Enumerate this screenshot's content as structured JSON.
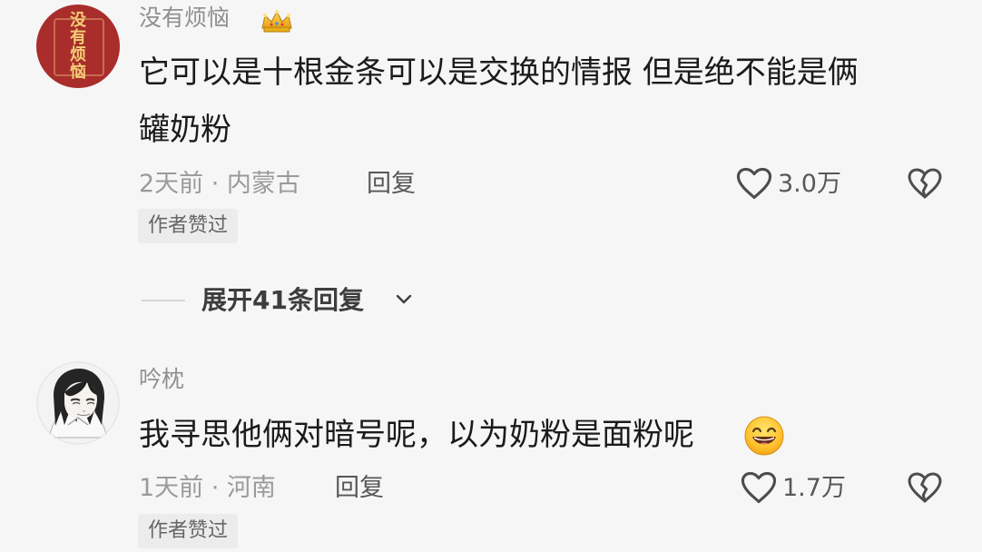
{
  "comments": [
    {
      "username": "没有烦恼",
      "badge_icon": "crown-icon",
      "avatar_text": [
        "没",
        "有",
        "烦",
        "恼"
      ],
      "text_line1": "它可以是十根金条可以是交换的情报  但是绝不能是俩",
      "text_line2": "罐奶粉",
      "meta": "2天前 · 内蒙古",
      "reply_label": "回复",
      "like_count": "3.0万",
      "author_tag": "作者赞过"
    },
    {
      "username": "吟枕",
      "text_line1": "我寻思他俩对暗号呢，以为奶粉是面粉呢",
      "emoji": "grinning-face-emoji",
      "meta": "1天前 · 河南",
      "reply_label": "回复",
      "like_count": "1.7万",
      "author_tag": "作者赞过"
    }
  ],
  "expand": {
    "label": "展开41条回复"
  },
  "colors": {
    "background": "#f6f6f6",
    "text_primary": "#1b1b1b",
    "text_secondary": "#9a9a9a",
    "avatar_red": "#a92d2b",
    "avatar_gold": "#f2cd76",
    "tag_bg": "#ececec",
    "emoji_yellow": "#f7b31d"
  }
}
